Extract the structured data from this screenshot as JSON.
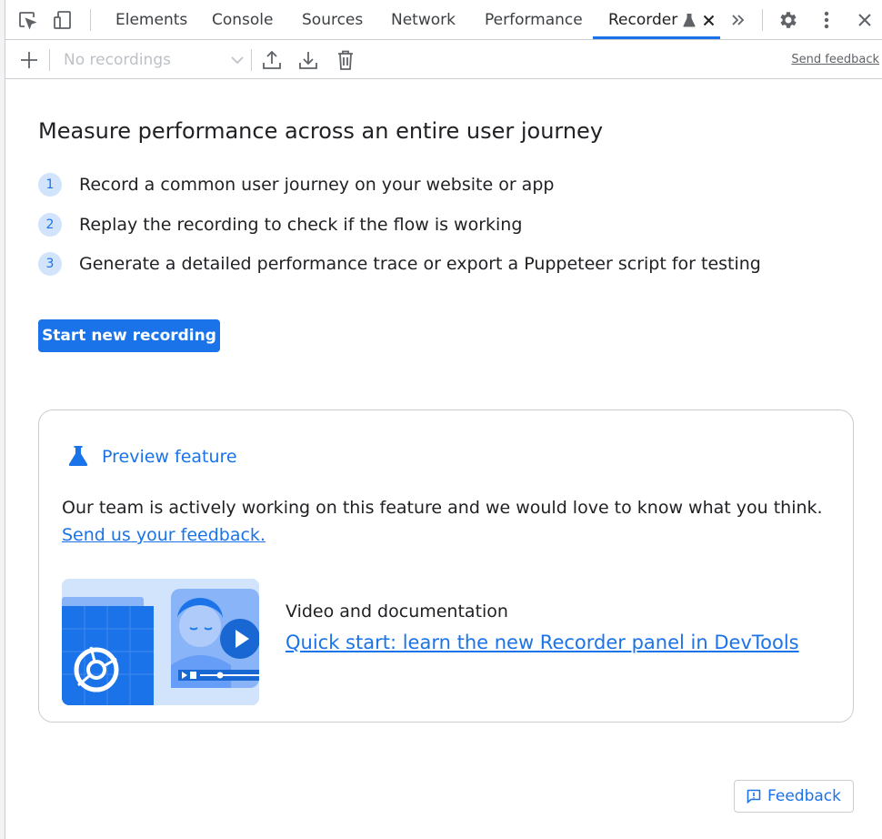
{
  "tabs": [
    {
      "label": "Elements"
    },
    {
      "label": "Console"
    },
    {
      "label": "Sources"
    },
    {
      "label": "Network"
    },
    {
      "label": "Performance"
    },
    {
      "label": "Recorder",
      "active": true
    }
  ],
  "toolbar": {
    "recordings_select_value": "No recordings",
    "send_feedback_label": "Send feedback"
  },
  "main": {
    "headline": "Measure performance across an entire user journey",
    "steps": [
      {
        "number": "1",
        "text": "Record a common user journey on your website or app"
      },
      {
        "number": "2",
        "text": "Replay the recording to check if the flow is working"
      },
      {
        "number": "3",
        "text": "Generate a detailed performance trace or export a Puppeteer script for testing"
      }
    ],
    "start_button_label": "Start new recording"
  },
  "preview_card": {
    "title": "Preview feature",
    "description": "Our team is actively working on this feature and we would love to know what you think.",
    "feedback_link": "Send us your feedback.",
    "video_label": "Video and documentation",
    "video_link": "Quick start: learn the new Recorder panel in DevTools"
  },
  "feedback_button_label": "Feedback",
  "icons": {
    "inspect": "inspect-element-icon",
    "device": "device-toolbar-icon",
    "experiment": "flask-icon",
    "close_tab": "close-icon",
    "more_tabs": "chevron-double-right-icon",
    "settings": "gear-icon",
    "menu": "kebab-menu-icon",
    "close_devtools": "close-icon",
    "add": "plus-icon",
    "export": "upload-icon",
    "import": "download-icon",
    "delete": "trash-icon",
    "feedback": "feedback-icon"
  },
  "colors": {
    "accent": "#1a73e8",
    "step_badge_bg": "#d2e3fc",
    "border": "#cbcdd1",
    "disabled_text": "#bdc1c6"
  }
}
